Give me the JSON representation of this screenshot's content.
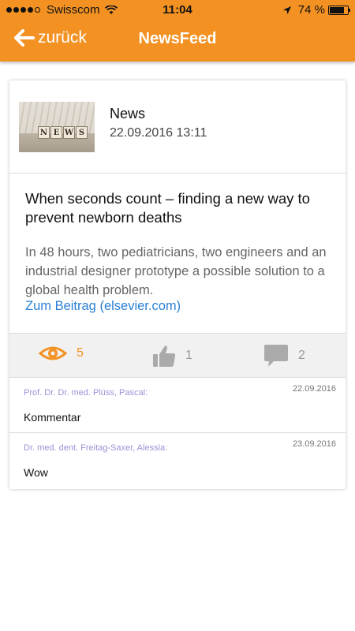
{
  "status_bar": {
    "carrier": "Swisscom",
    "time": "11:04",
    "battery": "74 %",
    "battery_level": 0.74,
    "signal_icon": "signal-dots-icon",
    "wifi_icon": "wifi-icon",
    "location_icon": "location-arrow-icon"
  },
  "navbar": {
    "back_label": "zurück",
    "title": "NewsFeed",
    "accent_color": "#f39223"
  },
  "post": {
    "category": "News",
    "datetime": "22.09.2016 13:11",
    "thumbnail_text": "NEWS",
    "title": "When seconds count – finding a new way to prevent newborn deaths",
    "body": "In 48 hours, two pediatricians, two engineers and an industrial designer prototype a possible solution to a global health problem.",
    "link": "Zum Beitrag (elsevier.com)",
    "link_color": "#2a7fd4"
  },
  "stats": {
    "views": "5",
    "likes": "1",
    "comments": "2"
  },
  "comments": [
    {
      "author": "Prof. Dr. Dr. med. Plüss, Pascal:",
      "date": "22.09.2016",
      "text": "Kommentar"
    },
    {
      "author": "Dr. med. dent. Freitag-Saxer, Alessia:",
      "date": "23.09.2016",
      "text": "Wow"
    }
  ]
}
